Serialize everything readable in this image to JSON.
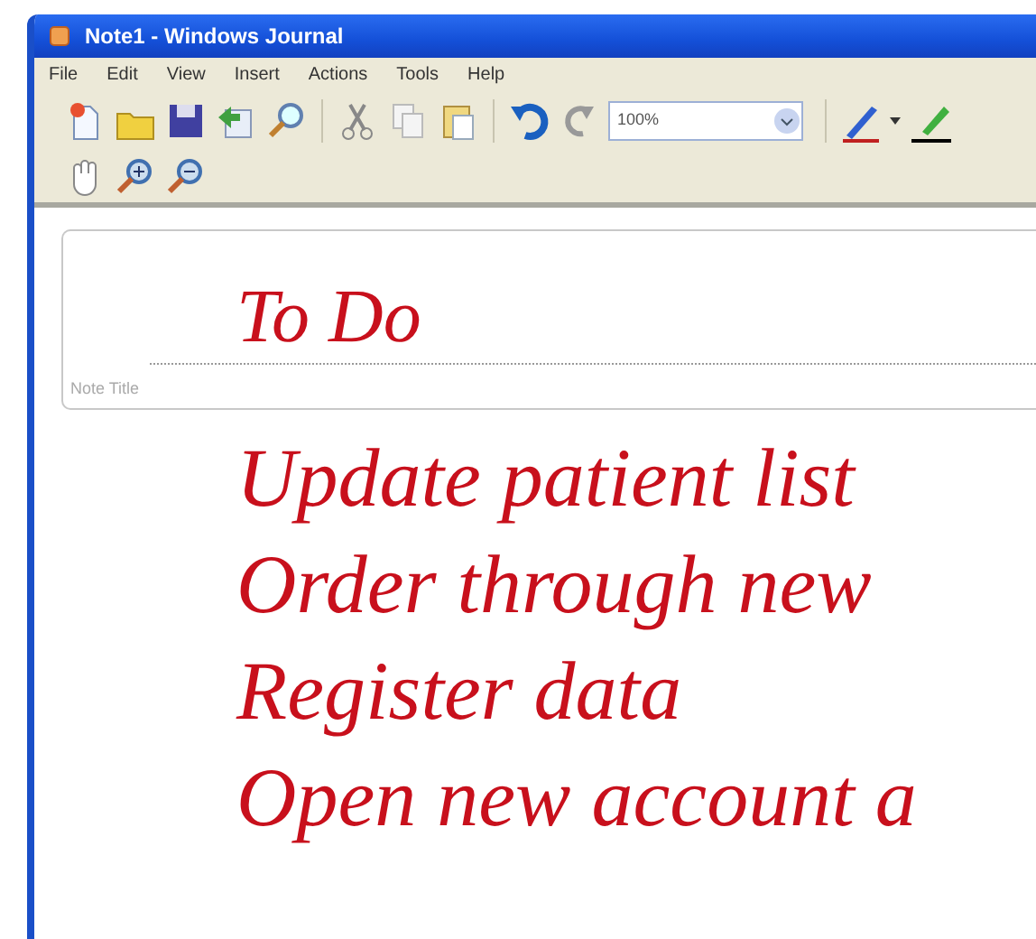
{
  "window": {
    "title": "Note1 - Windows Journal"
  },
  "menu": [
    "File",
    "Edit",
    "View",
    "Insert",
    "Actions",
    "Tools",
    "Help"
  ],
  "toolbar": {
    "zoom": "100%"
  },
  "note": {
    "title_label": "Note Title",
    "title": "To Do",
    "lines": [
      "Update patient list",
      "Order through new",
      "Register data",
      "Open new account a"
    ]
  }
}
